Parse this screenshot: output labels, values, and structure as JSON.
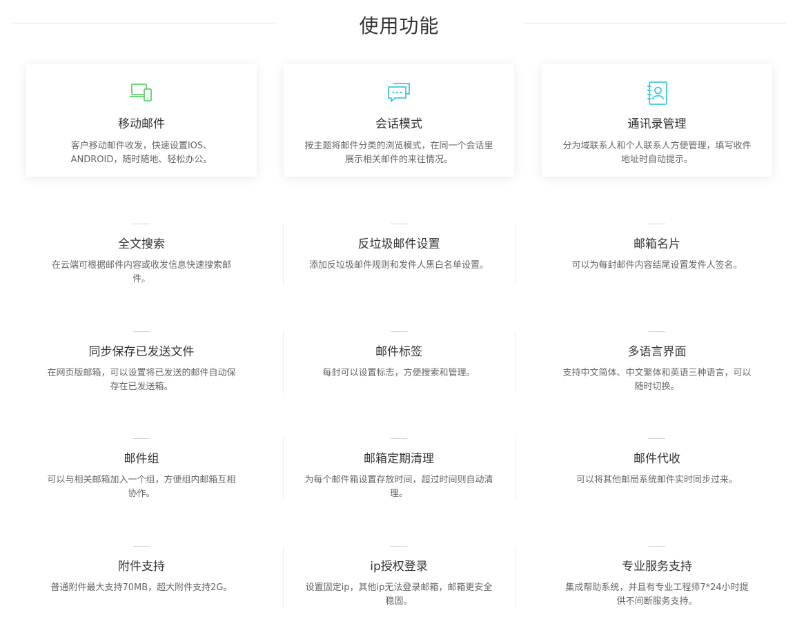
{
  "section": {
    "title": "使用功能"
  },
  "top_cards": [
    {
      "title": "移动邮件",
      "desc": "客户移动邮件收发，快速设置IOS、ANDROID，随时随地、轻松办公。",
      "icon": "mobile-devices-icon",
      "color": "#5ccf6e"
    },
    {
      "title": "会话模式",
      "desc": "按主题将邮件分类的浏览模式，在同一个会话里展示相关邮件的来往情况。",
      "icon": "chat-bubbles-icon",
      "color": "#3ec6e0"
    },
    {
      "title": "通讯录管理",
      "desc": "分为域联系人和个人联系人方便管理，填写收件地址时自动提示。",
      "icon": "contact-book-icon",
      "color": "#3ec6e0"
    }
  ],
  "features": [
    {
      "title": "全文搜索",
      "desc": "在云端可根据邮件内容或收发信息快速搜索邮件。"
    },
    {
      "title": "反垃圾邮件设置",
      "desc": "添加反垃圾邮件规则和发件人黑白名单设置。"
    },
    {
      "title": "邮箱名片",
      "desc": "可以为每封邮件内容结尾设置发件人签名。"
    },
    {
      "title": "同步保存已发送文件",
      "desc": "在网页版邮箱，可以设置将已发送的邮件自动保存在已发送箱。"
    },
    {
      "title": "邮件标签",
      "desc": "每封可以设置标志，方便搜索和管理。"
    },
    {
      "title": "多语言界面",
      "desc": "支持中文简体、中文繁体和英语三种语言，可以随时切换。"
    },
    {
      "title": "邮件组",
      "desc": "可以与相关邮箱加入一个组，方便组内邮箱互相协作。"
    },
    {
      "title": "邮箱定期清理",
      "desc": "为每个邮件箱设置存放时间，超过时间则自动清理。"
    },
    {
      "title": "邮件代收",
      "desc": "可以将其他邮局系统邮件实时同步过来。"
    },
    {
      "title": "附件支持",
      "desc": "普通附件最大支持70MB，超大附件支持2G。"
    },
    {
      "title": "ip授权登录",
      "desc": "设置固定ip，其他ip无法登录邮箱，邮箱更安全稳固。"
    },
    {
      "title": "专业服务支持",
      "desc": "集成帮助系统，并且有专业工程师7*24小时提供不间断服务支持。"
    }
  ]
}
